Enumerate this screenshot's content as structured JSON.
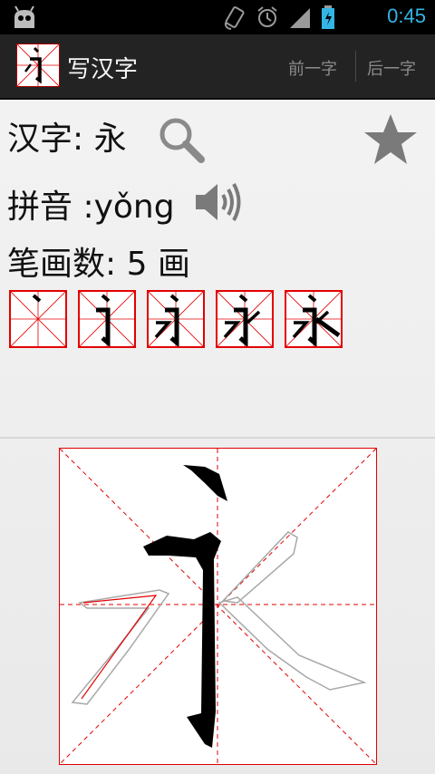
{
  "status_bar": {
    "time": "0:45",
    "icons": [
      "android-icon",
      "rotate-icon",
      "alarm-icon",
      "signal-icon",
      "battery-icon"
    ]
  },
  "action_bar": {
    "title": "写汉字",
    "prev_label": "前一字",
    "next_label": "后一字"
  },
  "info": {
    "char_label": "汉字:",
    "char_value": "永",
    "pinyin_label": "拼音 :",
    "pinyin_value": "yǒng",
    "strokes_label": "笔画数:",
    "strokes_value": "5",
    "strokes_unit": "画"
  },
  "colors": {
    "accent": "#33b5e5",
    "grid_red": "#e30000",
    "icon_gray": "#7a7a7a"
  }
}
